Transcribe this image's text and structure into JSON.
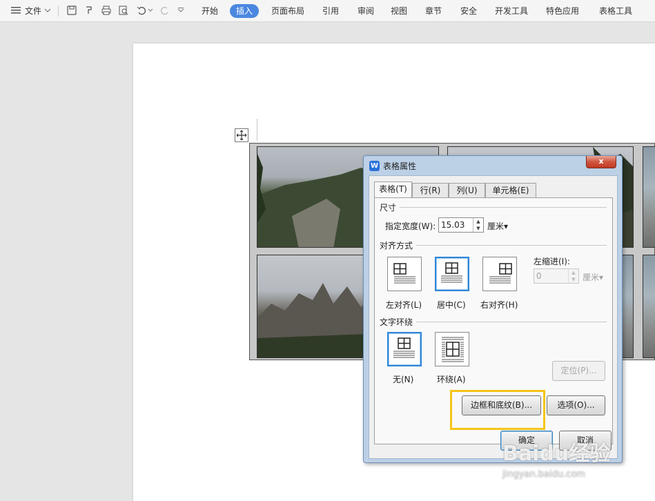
{
  "toolbar": {
    "file_label": "文件",
    "tabs": [
      "开始",
      "插入",
      "页面布局",
      "引用",
      "审阅",
      "视图",
      "章节",
      "安全",
      "开发工具",
      "特色应用",
      "表格工具"
    ],
    "active_tab": "插入",
    "active_color": "#4a87e0"
  },
  "dialog": {
    "title": "表格属性",
    "close_label": "x",
    "tabs": [
      "表格(T)",
      "行(R)",
      "列(U)",
      "单元格(E)"
    ],
    "size": {
      "section": "尺寸",
      "width_label": "指定宽度(W):",
      "width_value": "15.03",
      "unit": "厘米▾"
    },
    "alignment": {
      "section": "对齐方式",
      "options": [
        "左对齐(L)",
        "居中(C)",
        "右对齐(H)"
      ],
      "selected": "居中(C)",
      "indent_label": "左缩进(I):",
      "indent_value": "0",
      "indent_unit": "厘米▾"
    },
    "wrap": {
      "section": "文字环绕",
      "options": [
        "无(N)",
        "环绕(A)"
      ],
      "selected": "无(N)",
      "position_button": "定位(P)..."
    },
    "borders_button": "边框和底纹(B)...",
    "options_button": "选项(O)...",
    "ok_button": "确定",
    "cancel_button": "取消"
  },
  "watermark": {
    "brand": "Baidu经验",
    "url": "jingyan.baidu.com"
  },
  "colors": {
    "highlight": "#f5c518",
    "selected_border": "#2f86d8"
  }
}
